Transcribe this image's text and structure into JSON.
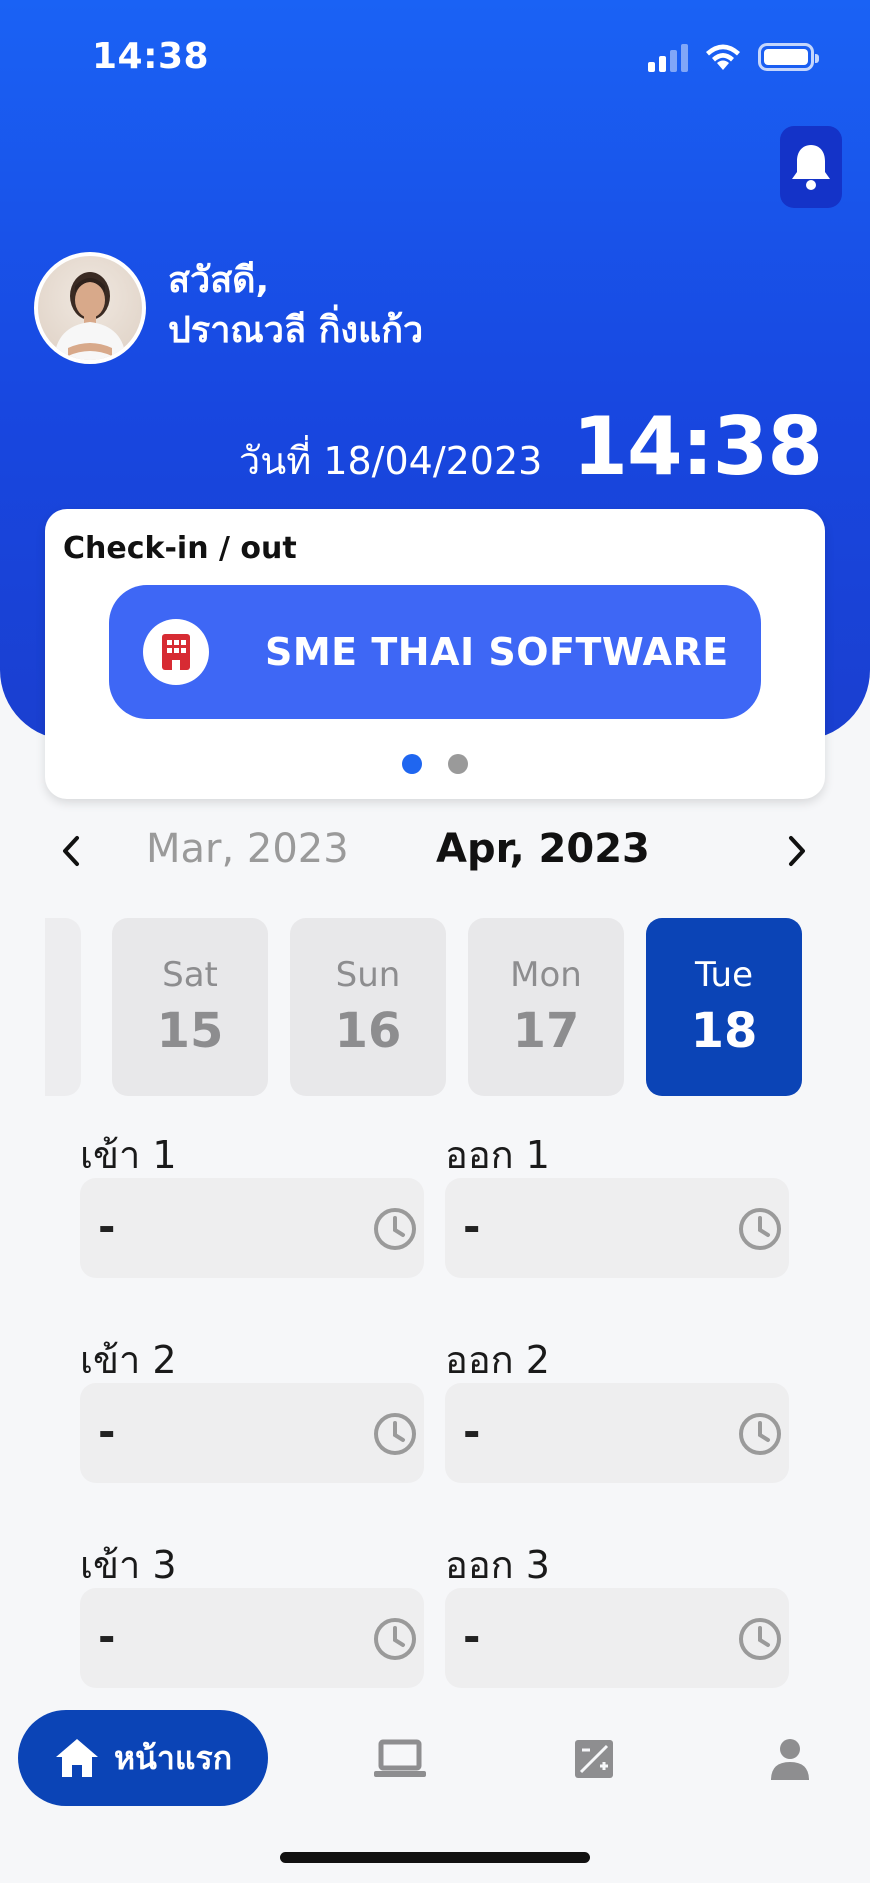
{
  "status_bar": {
    "time": "14:38"
  },
  "header": {
    "greeting": "สวัสดี,",
    "user_name": "ปราณวลี  กิ่งแก้ว",
    "date_text": "วันที่ 18/04/2023",
    "clock": "14:38"
  },
  "checkin": {
    "title": "Check-in / out",
    "company": "SME THAI SOFTWARE",
    "page_index": 1,
    "page_count": 2
  },
  "calendar": {
    "prev_month": "Mar, 2023",
    "current_month": "Apr, 2023",
    "days": [
      {
        "name": "Sat",
        "date": "15"
      },
      {
        "name": "Sun",
        "date": "16"
      },
      {
        "name": "Mon",
        "date": "17"
      },
      {
        "name": "Tue",
        "date": "18",
        "selected": true
      }
    ]
  },
  "attendance": {
    "rows": [
      {
        "in_label": "เข้า 1",
        "in_value": "-",
        "out_label": "ออก 1",
        "out_value": "-"
      },
      {
        "in_label": "เข้า 2",
        "in_value": "-",
        "out_label": "ออก 2",
        "out_value": "-"
      },
      {
        "in_label": "เข้า 3",
        "in_value": "-",
        "out_label": "ออก 3",
        "out_value": "-"
      }
    ]
  },
  "tabbar": {
    "home_label": "หน้าแรก",
    "tabs": [
      "home-icon",
      "laptop-icon",
      "edit-square-icon",
      "person-icon"
    ]
  },
  "colors": {
    "primary": "#1a55ef",
    "selected": "#0b44b6",
    "company_button": "#3e67f5"
  }
}
